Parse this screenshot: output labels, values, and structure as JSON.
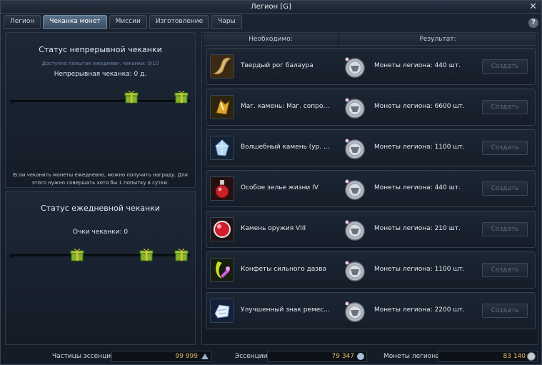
{
  "window": {
    "title": "Легион [G]"
  },
  "tabs": [
    {
      "label": "Легион"
    },
    {
      "label": "Чеканка монет"
    },
    {
      "label": "Миссии"
    },
    {
      "label": "Изготовление"
    },
    {
      "label": "Чары"
    }
  ],
  "continuous": {
    "title": "Статус непрерывной чеканки",
    "attempts_hint": "Доступно попыток ежедневн. чеканки: 0/10",
    "days_line": "Непрерывная чеканка: 0 д.",
    "note": "Если чеканить монеты ежедневно, можно получить награду. Для этого нужно совершать хотя бы 1 попытку в сутки."
  },
  "daily": {
    "title": "Статус ежедневной чеканки",
    "points_line": "Очки чеканки: 0"
  },
  "table": {
    "col_required": "Необходимо:",
    "col_result": "Результат:",
    "create_label": "Создать",
    "rows": [
      {
        "item": "Твердый рог балаура",
        "icon": "horn-icon",
        "result": "Монеты легиона: 440 шт."
      },
      {
        "item": "Маг. камень: Маг. сопро...",
        "icon": "magic-stone-icon",
        "result": "Монеты легиона: 6600 шт."
      },
      {
        "item": "Волшебный камень (ур. ...",
        "icon": "crystal-icon",
        "result": "Монеты легиона: 1100 шт."
      },
      {
        "item": "Особое зелье жизни IV",
        "icon": "potion-icon",
        "result": "Монеты легиона: 440 шт."
      },
      {
        "item": "Камень оружия VIII",
        "icon": "weapon-stone-icon",
        "result": "Монеты легиона: 210 шт."
      },
      {
        "item": "Конфеты сильного даэва",
        "icon": "candy-icon",
        "result": "Монеты легиона: 1100 шт."
      },
      {
        "item": "Улучшенный знак ремес...",
        "icon": "craft-mark-icon",
        "result": "Монеты легиона: 2200 шт."
      }
    ]
  },
  "footer": {
    "particles_label": "Частицы эссенции",
    "particles_value": "99 999",
    "essence_label": "Эссенции",
    "essence_value": "79 347",
    "coins_label": "Монеты легиона",
    "coins_value": "83 140"
  },
  "colors": {
    "accent": "#e8b860",
    "tab_active": "#4a6178",
    "gift": "#9ccf3a"
  }
}
